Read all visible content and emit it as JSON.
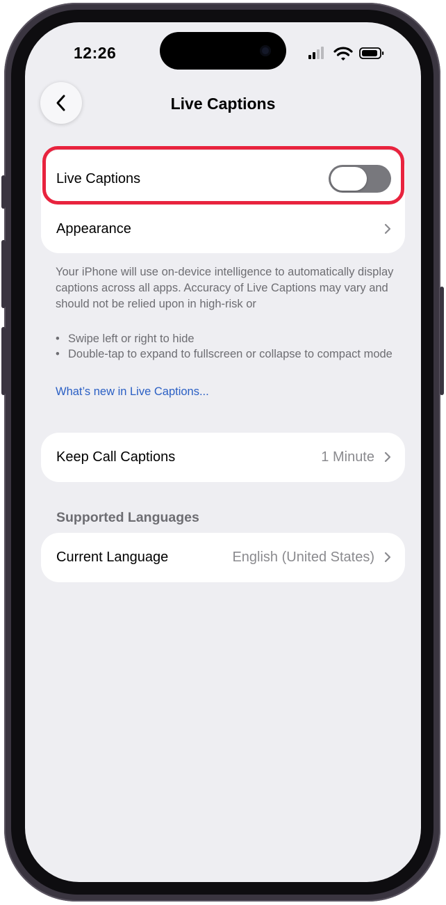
{
  "status_bar": {
    "time": "12:26",
    "icons": [
      "cellular-signal-icon",
      "wifi-icon",
      "battery-icon"
    ]
  },
  "nav": {
    "back_icon": "chevron-left-icon",
    "title": "Live Captions"
  },
  "main_card": {
    "live_captions_label": "Live Captions",
    "live_captions_toggle_on": false,
    "appearance_label": "Appearance"
  },
  "description": {
    "line1": "Your iPhone will use on-device intelligence to automatically display captions across all apps. Accuracy of Live Captions may vary and should not be relied upon in high-risk or",
    "bullets": [
      "Swipe left or right to hide",
      "Double-tap to expand to fullscreen or collapse to compact mode"
    ],
    "link": "What’s new in Live Captions..."
  },
  "call_card": {
    "label": "Keep Call Captions",
    "value": "1 Minute"
  },
  "languages": {
    "header": "Supported Languages",
    "label": "Current Language",
    "value": "English (United States)"
  },
  "colors": {
    "highlight": "#e8233e",
    "link": "#2a5fc4",
    "toggle_off": "#78787d",
    "background": "#eeeef2"
  }
}
